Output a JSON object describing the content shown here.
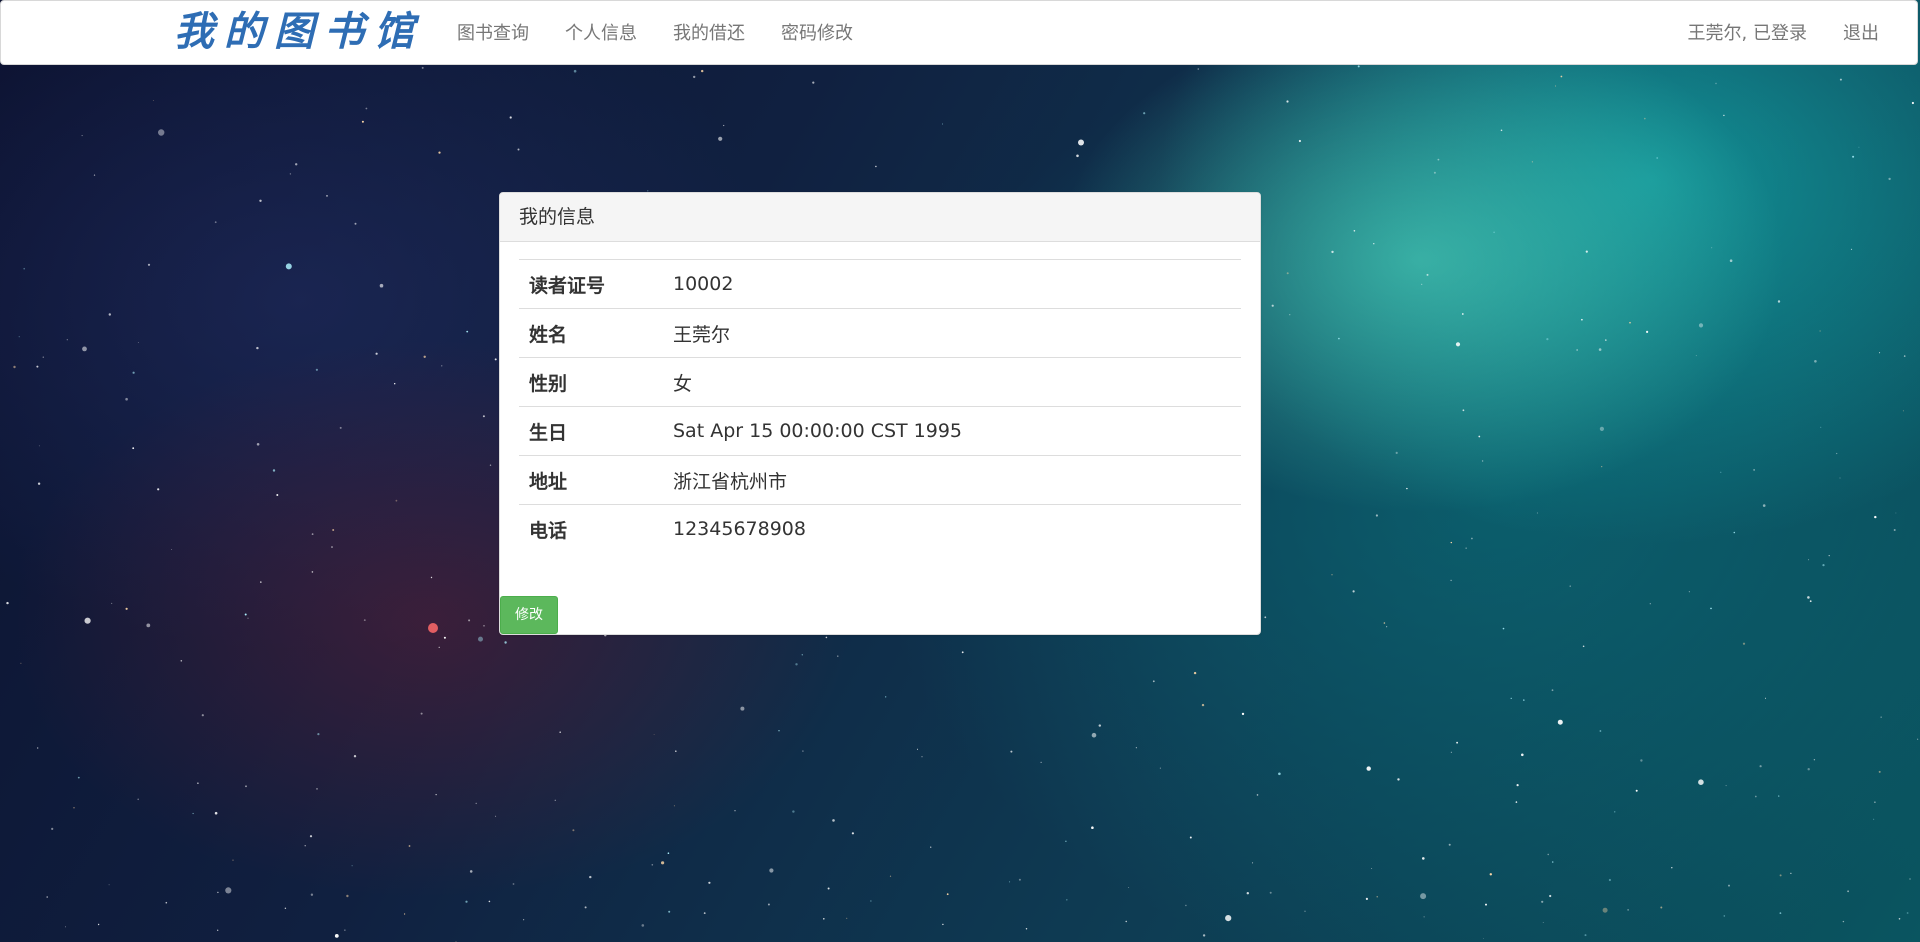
{
  "navbar": {
    "brand": "我的图书馆",
    "links": [
      {
        "label": "图书查询"
      },
      {
        "label": "个人信息"
      },
      {
        "label": "我的借还"
      },
      {
        "label": "密码修改"
      }
    ],
    "user_status": "王莞尔, 已登录",
    "logout": "退出"
  },
  "panel": {
    "title": "我的信息",
    "rows": [
      {
        "label": "读者证号",
        "value": "10002"
      },
      {
        "label": "姓名",
        "value": "王莞尔"
      },
      {
        "label": "性别",
        "value": "女"
      },
      {
        "label": "生日",
        "value": "Sat Apr 15 00:00:00 CST 1995"
      },
      {
        "label": "地址",
        "value": "浙江省杭州市"
      },
      {
        "label": "电话",
        "value": "12345678908"
      }
    ],
    "edit_button": "修改"
  }
}
